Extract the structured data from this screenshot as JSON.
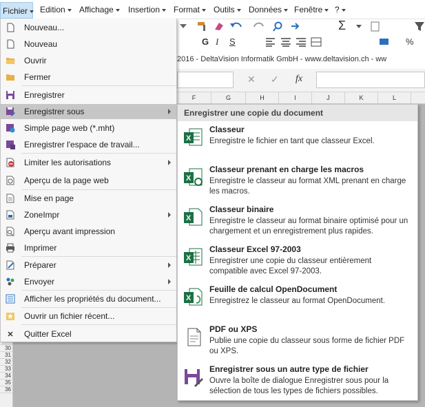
{
  "menubar": {
    "items": [
      "Fichier",
      "Edition",
      "Affichage",
      "Insertion",
      "Format",
      "Outils",
      "Données",
      "Fenêtre",
      "?"
    ]
  },
  "toolbar": {
    "bold": "G",
    "italic": "I",
    "underline": "S",
    "sigma": "Σ",
    "percent": "%"
  },
  "namebar": {
    "text": "2016  -  DeltaVision Informatik GmbH  -  www.deltavision.ch  -  ww"
  },
  "formulabar": {
    "cancel": "✕",
    "confirm": "✓",
    "fx": "fx"
  },
  "columns": [
    "F",
    "G",
    "H",
    "I",
    "J",
    "K",
    "L"
  ],
  "rows": [
    "30",
    "31",
    "32",
    "33",
    "34",
    "35",
    "36"
  ],
  "file_menu": {
    "items": [
      {
        "label": "Nouveau...",
        "icon": "new-document-icon"
      },
      {
        "label": "Nouveau",
        "icon": "new-document-icon"
      },
      {
        "label": "Ouvrir",
        "icon": "open-folder-icon"
      },
      {
        "label": "Fermer",
        "icon": "close-folder-icon"
      },
      {
        "label": "Enregistrer",
        "icon": "save-icon"
      },
      {
        "label": "Enregistrer sous",
        "icon": "save-as-icon",
        "submenu": true,
        "highlighted": true
      },
      {
        "label": "Simple page web (*.mht)",
        "icon": "save-web-icon"
      },
      {
        "label": "Enregistrer l'espace de travail...",
        "icon": "save-workspace-icon"
      },
      {
        "label": "Limiter les autorisations",
        "icon": "restrict-icon",
        "submenu": true
      },
      {
        "label": "Aperçu de la page web",
        "icon": "web-preview-icon"
      },
      {
        "label": "Mise en page",
        "icon": "page-setup-icon"
      },
      {
        "label": "ZoneImpr",
        "icon": "print-area-icon",
        "submenu": true
      },
      {
        "label": "Aperçu avant impression",
        "icon": "print-preview-icon"
      },
      {
        "label": "Imprimer",
        "icon": "printer-icon"
      },
      {
        "label": "Préparer",
        "icon": "prepare-icon",
        "submenu": true
      },
      {
        "label": "Envoyer",
        "icon": "send-icon",
        "submenu": true
      },
      {
        "label": "Afficher les propriétés du document...",
        "icon": "properties-icon"
      },
      {
        "label": "Ouvrir un fichier récent...",
        "icon": "recent-star-icon"
      },
      {
        "label": "Quitter Excel",
        "icon": "exit-x-icon"
      }
    ]
  },
  "save_as_submenu": {
    "header": "Enregistrer une copie du document",
    "items": [
      {
        "title": "Classeur",
        "desc": "Enregistre le fichier en tant que classeur Excel."
      },
      {
        "title": "Classeur prenant en charge les macros",
        "desc": "Enregistre le classeur au format XML prenant en charge les macros."
      },
      {
        "title": "Classeur binaire",
        "desc": "Enregistre le classeur au format binaire optimisé pour un chargement et un enregistrement plus rapides."
      },
      {
        "title": "Classeur Excel 97-2003",
        "desc": "Enregistrer une copie du classeur entièrement compatible avec Excel 97-2003."
      },
      {
        "title": "Feuille de calcul OpenDocument",
        "desc": "Enregistrez le classeur au format OpenDocument."
      },
      {
        "title": "PDF ou XPS",
        "desc": "Publie une copie du classeur sous forme de fichier PDF ou XPS."
      },
      {
        "title": "Enregistrer sous un autre type de fichier",
        "desc": "Ouvre la boîte de dialogue Enregistrer sous pour la sélection de tous les types de fichiers possibles."
      }
    ]
  },
  "colors": {
    "excel_green": "#1d7044",
    "highlight": "#c6c6c6",
    "menubar_active": "#cde4f7",
    "purple_save": "#7a4a9a"
  }
}
